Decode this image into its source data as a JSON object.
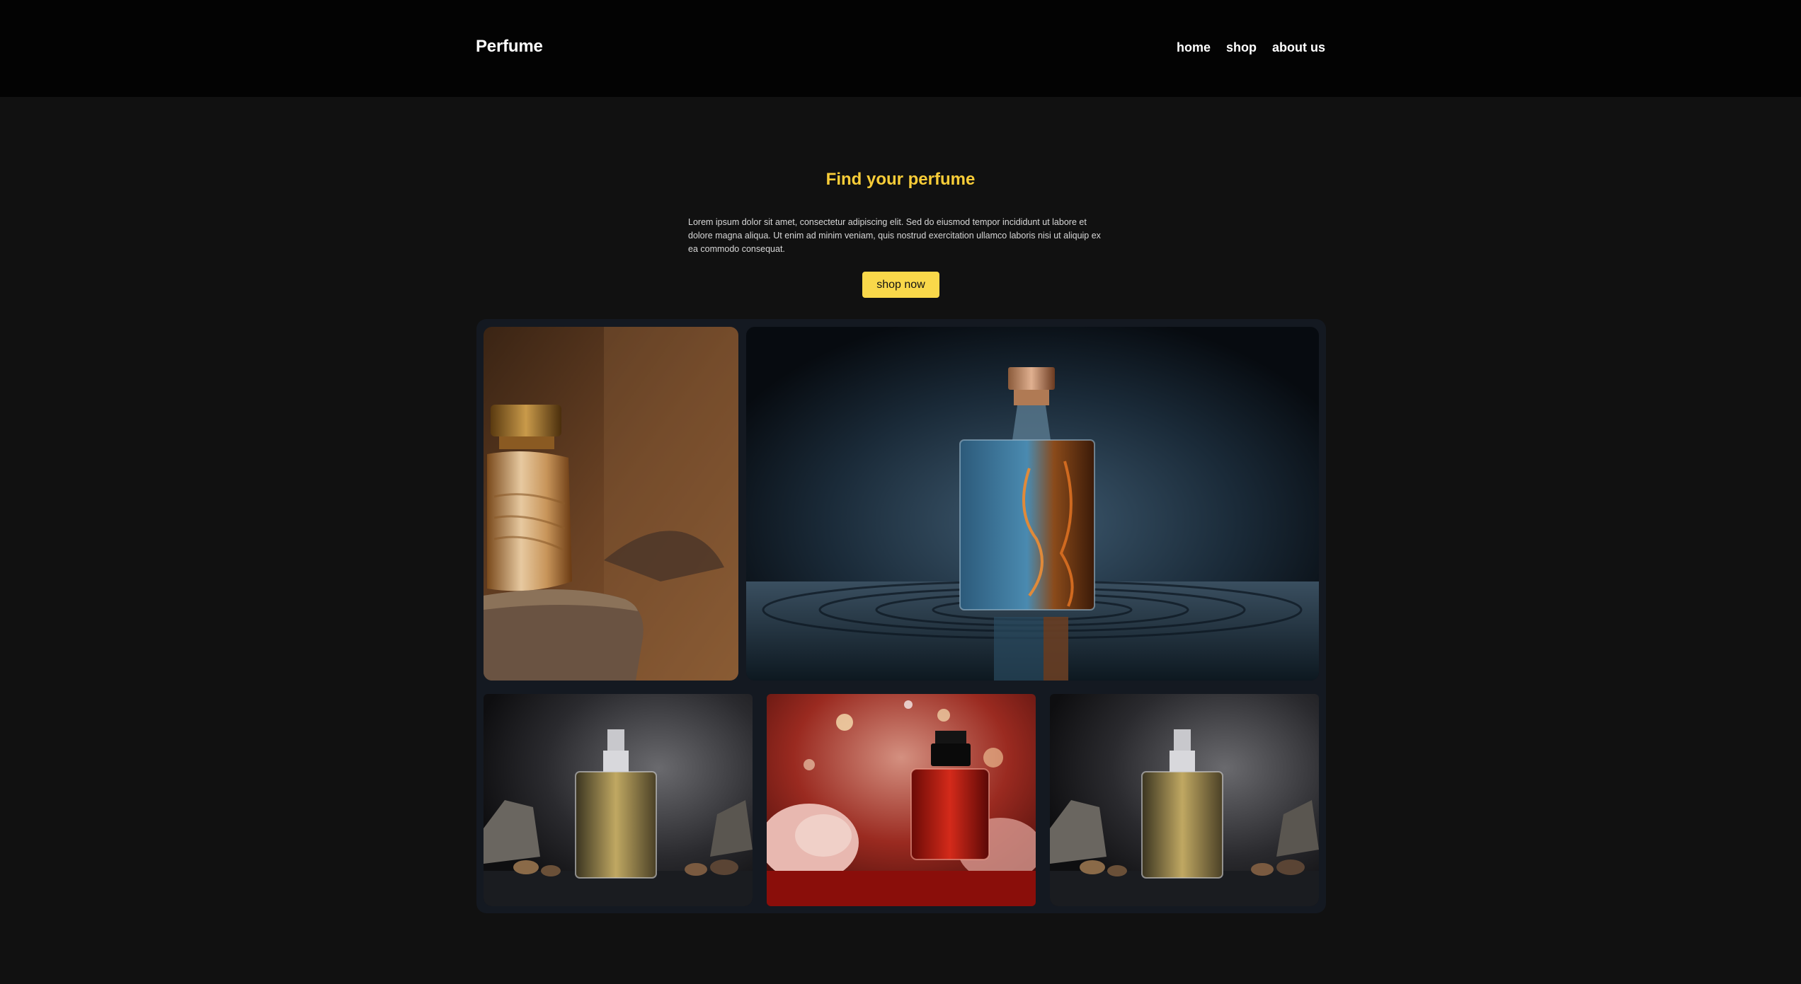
{
  "nav": {
    "brand": "Perfume",
    "links": [
      "home",
      "shop",
      "about us"
    ]
  },
  "hero": {
    "title": "Find your perfume",
    "text": "Lorem ipsum dolor sit amet, consectetur adipiscing elit. Sed do eiusmod tempor incididunt ut labore et dolore magna aliqua. Ut enim ad minim veniam, quis nostrud exercitation ullamco laboris nisi ut aliquip ex ea commodo consequat.",
    "button_label": "shop now"
  },
  "colors": {
    "accent": "#f9cd38",
    "button": "#f9d84a",
    "background": "#111111",
    "navbar": "#030303",
    "gallery_panel": "#141921"
  },
  "gallery": {
    "images": [
      "amber-perfume-bottle-on-stone",
      "blue-perfume-bottle-on-water",
      "gold-perfume-bottle-with-stones",
      "red-perfume-bottle-with-flowers",
      "gold-perfume-bottle-with-stones"
    ]
  }
}
